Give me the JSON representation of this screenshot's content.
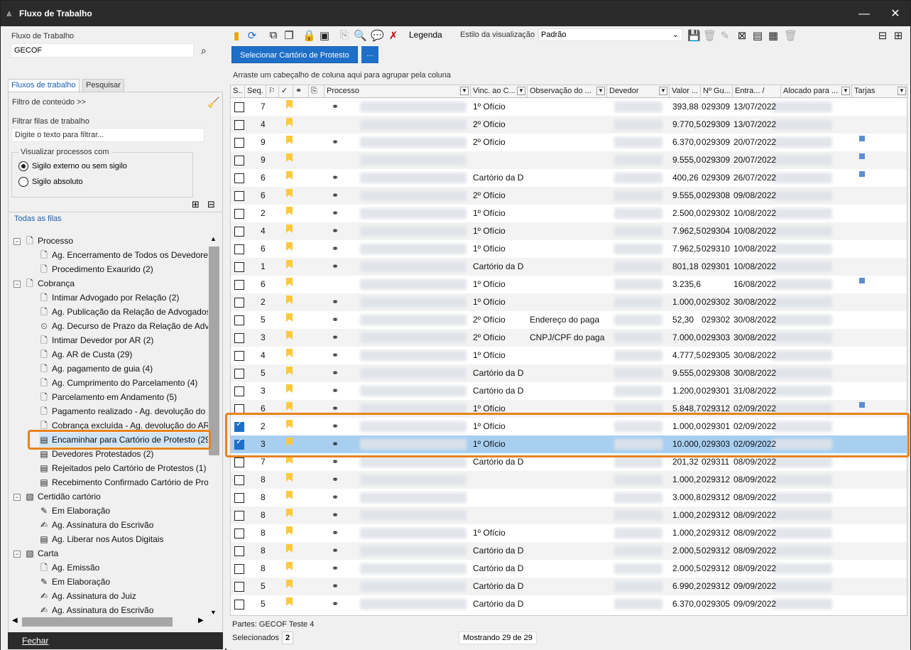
{
  "window": {
    "title": "Fluxo de Trabalho",
    "minimize": "—",
    "close": "✕"
  },
  "left": {
    "workflow_label": "Fluxo de Trabalho",
    "workflow_value": "GECOF",
    "tabs": [
      "Fluxos de trabalho",
      "Pesquisar"
    ],
    "filter_content": "Filtro de conteúdo >>",
    "filter_queues_label": "Filtrar filas de trabalho",
    "filter_queues_placeholder": "Digite o texto para filtrar...",
    "visualize_label": "Visualizar processos com",
    "radio_external": "Sigilo externo ou sem sigilo",
    "radio_absolute": "Sigilo absoluto",
    "all_queues": "Todas as filas",
    "tree": [
      {
        "label": "Processo",
        "level": 0,
        "icon": "doc-icon"
      },
      {
        "label": "Ag. Encerramento de Todos os Devedores",
        "level": 1,
        "icon": "doc-icon"
      },
      {
        "label": "Procedimento Exaurido (2)",
        "level": 1,
        "icon": "doc-icon"
      },
      {
        "label": "Cobrança",
        "level": 0,
        "icon": "doc-icon"
      },
      {
        "label": "Intimar Advogado por Relação (2)",
        "level": 1,
        "icon": "doc-icon"
      },
      {
        "label": "Ag. Publicação da Relação de Advogados",
        "level": 1,
        "icon": "doc-icon"
      },
      {
        "label": "Ag. Decurso de Prazo da Relação de Advo",
        "level": 1,
        "icon": "clock-doc-icon"
      },
      {
        "label": "Intimar Devedor por AR (2)",
        "level": 1,
        "icon": "doc-icon"
      },
      {
        "label": "Ag. AR de Custa (29)",
        "level": 1,
        "icon": "doc-icon"
      },
      {
        "label": "Ag. pagamento de guia (4)",
        "level": 1,
        "icon": "doc-icon"
      },
      {
        "label": "Ag. Cumprimento do Parcelamento (4)",
        "level": 1,
        "icon": "doc-icon"
      },
      {
        "label": "Parcelamento em Andamento (5)",
        "level": 1,
        "icon": "doc-icon"
      },
      {
        "label": "Pagamento realizado - Ag. devolução do",
        "level": 1,
        "icon": "doc-icon"
      },
      {
        "label": "Cobrança excluída - Ag. devolução do AR",
        "level": 1,
        "icon": "doc-icon"
      },
      {
        "label": "Encaminhar para Cartório de Protesto (29",
        "level": 1,
        "icon": "queue-icon",
        "selected": true
      },
      {
        "label": "Devedores Protestados (2)",
        "level": 1,
        "icon": "queue-icon"
      },
      {
        "label": "Rejeitados pelo Cartório de Protestos (1)",
        "level": 1,
        "icon": "queue-icon"
      },
      {
        "label": "Recebimento Confirmado Cartório de Prot",
        "level": 1,
        "icon": "queue-icon"
      },
      {
        "label": "Certidão cartório",
        "level": 0,
        "icon": "cert-icon"
      },
      {
        "label": "Em Elaboração",
        "level": 1,
        "icon": "pen-icon"
      },
      {
        "label": "Ag. Assinatura do Escrivão",
        "level": 1,
        "icon": "sign-icon"
      },
      {
        "label": "Ag. Liberar nos Autos Digitais",
        "level": 1,
        "icon": "queue-icon"
      },
      {
        "label": "Carta",
        "level": 0,
        "icon": "cert-icon"
      },
      {
        "label": "Ag. Emissão",
        "level": 1,
        "icon": "doc-icon"
      },
      {
        "label": "Em Elaboração",
        "level": 1,
        "icon": "pen-icon"
      },
      {
        "label": "Ag. Assinatura do Juiz",
        "level": 1,
        "icon": "sign-icon"
      },
      {
        "label": "Ag. Assinatura do Escrivão",
        "level": 1,
        "icon": "sign-icon"
      }
    ],
    "close_button": "Fechar"
  },
  "toolbar": {
    "legend": "Legenda",
    "style_label": "Estilo da visualização",
    "style_value": "Padrão",
    "select_button": "Selecionar Cartório de Protesto",
    "dots_button": "..."
  },
  "grid": {
    "group_hint": "Arraste um cabeçalho de coluna aqui para agrupar pela coluna",
    "headers": [
      "S..",
      "Seq.",
      "",
      "",
      "",
      "",
      "Processo",
      "Vinc. ao C...",
      "Observação do ...",
      "Devedor",
      "Valor ...",
      "Nº Gu...",
      "Entra... /",
      "Alocado para ...",
      "Tarjas"
    ],
    "rows": [
      {
        "chk": false,
        "seq": "7",
        "link": true,
        "vinc": "1º Ofício",
        "obs": "",
        "valor": "393,88",
        "guia": "029309",
        "data": "13/07/2022",
        "tarja": false
      },
      {
        "chk": false,
        "seq": "4",
        "link": false,
        "vinc": "2º Ofício",
        "obs": "",
        "valor": "9.770,5",
        "guia": "029309",
        "data": "13/07/2022",
        "tarja": false
      },
      {
        "chk": false,
        "seq": "9",
        "link": true,
        "vinc": "2º Ofício",
        "obs": "",
        "valor": "6.370,0",
        "guia": "029309",
        "data": "20/07/2022",
        "tarja": true
      },
      {
        "chk": false,
        "seq": "9",
        "link": false,
        "vinc": "",
        "obs": "",
        "valor": "9.555,0",
        "guia": "029309",
        "data": "20/07/2022",
        "tarja": true
      },
      {
        "chk": false,
        "seq": "6",
        "link": true,
        "vinc": "Cartório da D",
        "obs": "",
        "valor": "400,26",
        "guia": "029309",
        "data": "26/07/2022",
        "tarja": true
      },
      {
        "chk": false,
        "seq": "6",
        "link": true,
        "vinc": "2º Ofício",
        "obs": "",
        "valor": "9.555,0",
        "guia": "029308",
        "data": "09/08/2022",
        "tarja": false
      },
      {
        "chk": false,
        "seq": "2",
        "link": true,
        "vinc": "1º Ofício",
        "obs": "",
        "valor": "2.500,0",
        "guia": "029302",
        "data": "10/08/2022",
        "tarja": false
      },
      {
        "chk": false,
        "seq": "4",
        "link": true,
        "vinc": "1º Ofício",
        "obs": "",
        "valor": "7.962,5",
        "guia": "029304",
        "data": "10/08/2022",
        "tarja": false
      },
      {
        "chk": false,
        "seq": "6",
        "link": true,
        "vinc": "1º Ofício",
        "obs": "",
        "valor": "7.962,5",
        "guia": "029310",
        "data": "10/08/2022",
        "tarja": false
      },
      {
        "chk": false,
        "seq": "1",
        "link": true,
        "vinc": "Cartório da D",
        "obs": "",
        "valor": "801,18",
        "guia": "029301",
        "data": "10/08/2022",
        "tarja": false
      },
      {
        "chk": false,
        "seq": "6",
        "link": false,
        "vinc": "1º Ofício",
        "obs": "",
        "valor": "3.235,6",
        "guia": "",
        "data": "16/08/2022",
        "tarja": true
      },
      {
        "chk": false,
        "seq": "2",
        "link": true,
        "vinc": "1º Ofício",
        "obs": "",
        "valor": "1.000,0",
        "guia": "029302",
        "data": "30/08/2022",
        "tarja": false
      },
      {
        "chk": false,
        "seq": "5",
        "link": true,
        "vinc": "2º Ofício",
        "obs": "Endereço do paga",
        "valor": "52,30",
        "guia": "029302",
        "data": "30/08/2022",
        "tarja": false
      },
      {
        "chk": false,
        "seq": "3",
        "link": true,
        "vinc": "2º Ofício",
        "obs": "CNPJ/CPF do paga",
        "valor": "7.000,0",
        "guia": "029303",
        "data": "30/08/2022",
        "tarja": false
      },
      {
        "chk": false,
        "seq": "4",
        "link": true,
        "vinc": "1º Ofício",
        "obs": "",
        "valor": "4.777,5",
        "guia": "029305",
        "data": "30/08/2022",
        "tarja": false
      },
      {
        "chk": false,
        "seq": "5",
        "link": true,
        "vinc": "Cartório da D",
        "obs": "",
        "valor": "9.555,0",
        "guia": "029308",
        "data": "30/08/2022",
        "tarja": false
      },
      {
        "chk": false,
        "seq": "3",
        "link": true,
        "vinc": "Cartório da D",
        "obs": "",
        "valor": "1.200,0",
        "guia": "029301",
        "data": "31/08/2022",
        "tarja": false
      },
      {
        "chk": false,
        "seq": "6",
        "link": true,
        "vinc": "1º Ofício",
        "obs": "",
        "valor": "5.848,7",
        "guia": "029312",
        "data": "02/09/2022",
        "tarja": true
      },
      {
        "chk": true,
        "seq": "2",
        "link": true,
        "vinc": "1º Ofício",
        "obs": "",
        "valor": "1.000,0",
        "guia": "029301",
        "data": "02/09/2022",
        "tarja": false
      },
      {
        "chk": true,
        "seq": "3",
        "link": true,
        "vinc": "1º Ofício",
        "obs": "",
        "valor": "10.000,",
        "guia": "029303",
        "data": "02/09/2022",
        "tarja": false,
        "selected": true
      },
      {
        "chk": false,
        "seq": "7",
        "link": true,
        "vinc": "Cartório da D",
        "obs": "",
        "valor": "201,32",
        "guia": "029311",
        "data": "08/09/2022",
        "tarja": false
      },
      {
        "chk": false,
        "seq": "8",
        "link": true,
        "vinc": "",
        "obs": "",
        "valor": "1.000,2",
        "guia": "029312",
        "data": "08/09/2022",
        "tarja": false
      },
      {
        "chk": false,
        "seq": "8",
        "link": true,
        "vinc": "",
        "obs": "",
        "valor": "3.000,8",
        "guia": "029312",
        "data": "08/09/2022",
        "tarja": false
      },
      {
        "chk": false,
        "seq": "8",
        "link": true,
        "vinc": "",
        "obs": "",
        "valor": "1.000,2",
        "guia": "029312",
        "data": "08/09/2022",
        "tarja": false
      },
      {
        "chk": false,
        "seq": "8",
        "link": true,
        "vinc": "1º Ofício",
        "obs": "",
        "valor": "1.000,2",
        "guia": "029312",
        "data": "08/09/2022",
        "tarja": false
      },
      {
        "chk": false,
        "seq": "8",
        "link": true,
        "vinc": "Cartório da D",
        "obs": "",
        "valor": "2.000,5",
        "guia": "029312",
        "data": "08/09/2022",
        "tarja": false
      },
      {
        "chk": false,
        "seq": "8",
        "link": true,
        "vinc": "Cartório da D",
        "obs": "",
        "valor": "2.000,5",
        "guia": "029312",
        "data": "08/09/2022",
        "tarja": false
      },
      {
        "chk": false,
        "seq": "5",
        "link": true,
        "vinc": "Cartório da D",
        "obs": "",
        "valor": "6.990,2",
        "guia": "029312",
        "data": "09/09/2022",
        "tarja": false
      },
      {
        "chk": false,
        "seq": "5",
        "link": true,
        "vinc": "Cartório da D",
        "obs": "",
        "valor": "6.370,0",
        "guia": "029305",
        "data": "09/09/2022",
        "tarja": false
      }
    ]
  },
  "footer": {
    "partes": "Partes: GECOF Teste 4",
    "selecionados_label": "Selecionados",
    "selecionados_value": "2",
    "mostrando": "Mostrando 29 de 29"
  },
  "colors": {
    "accent": "#1e6fc8",
    "highlight": "#e8821e",
    "selected_row": "#a8cff0",
    "bookmark": "#ffc83d"
  }
}
